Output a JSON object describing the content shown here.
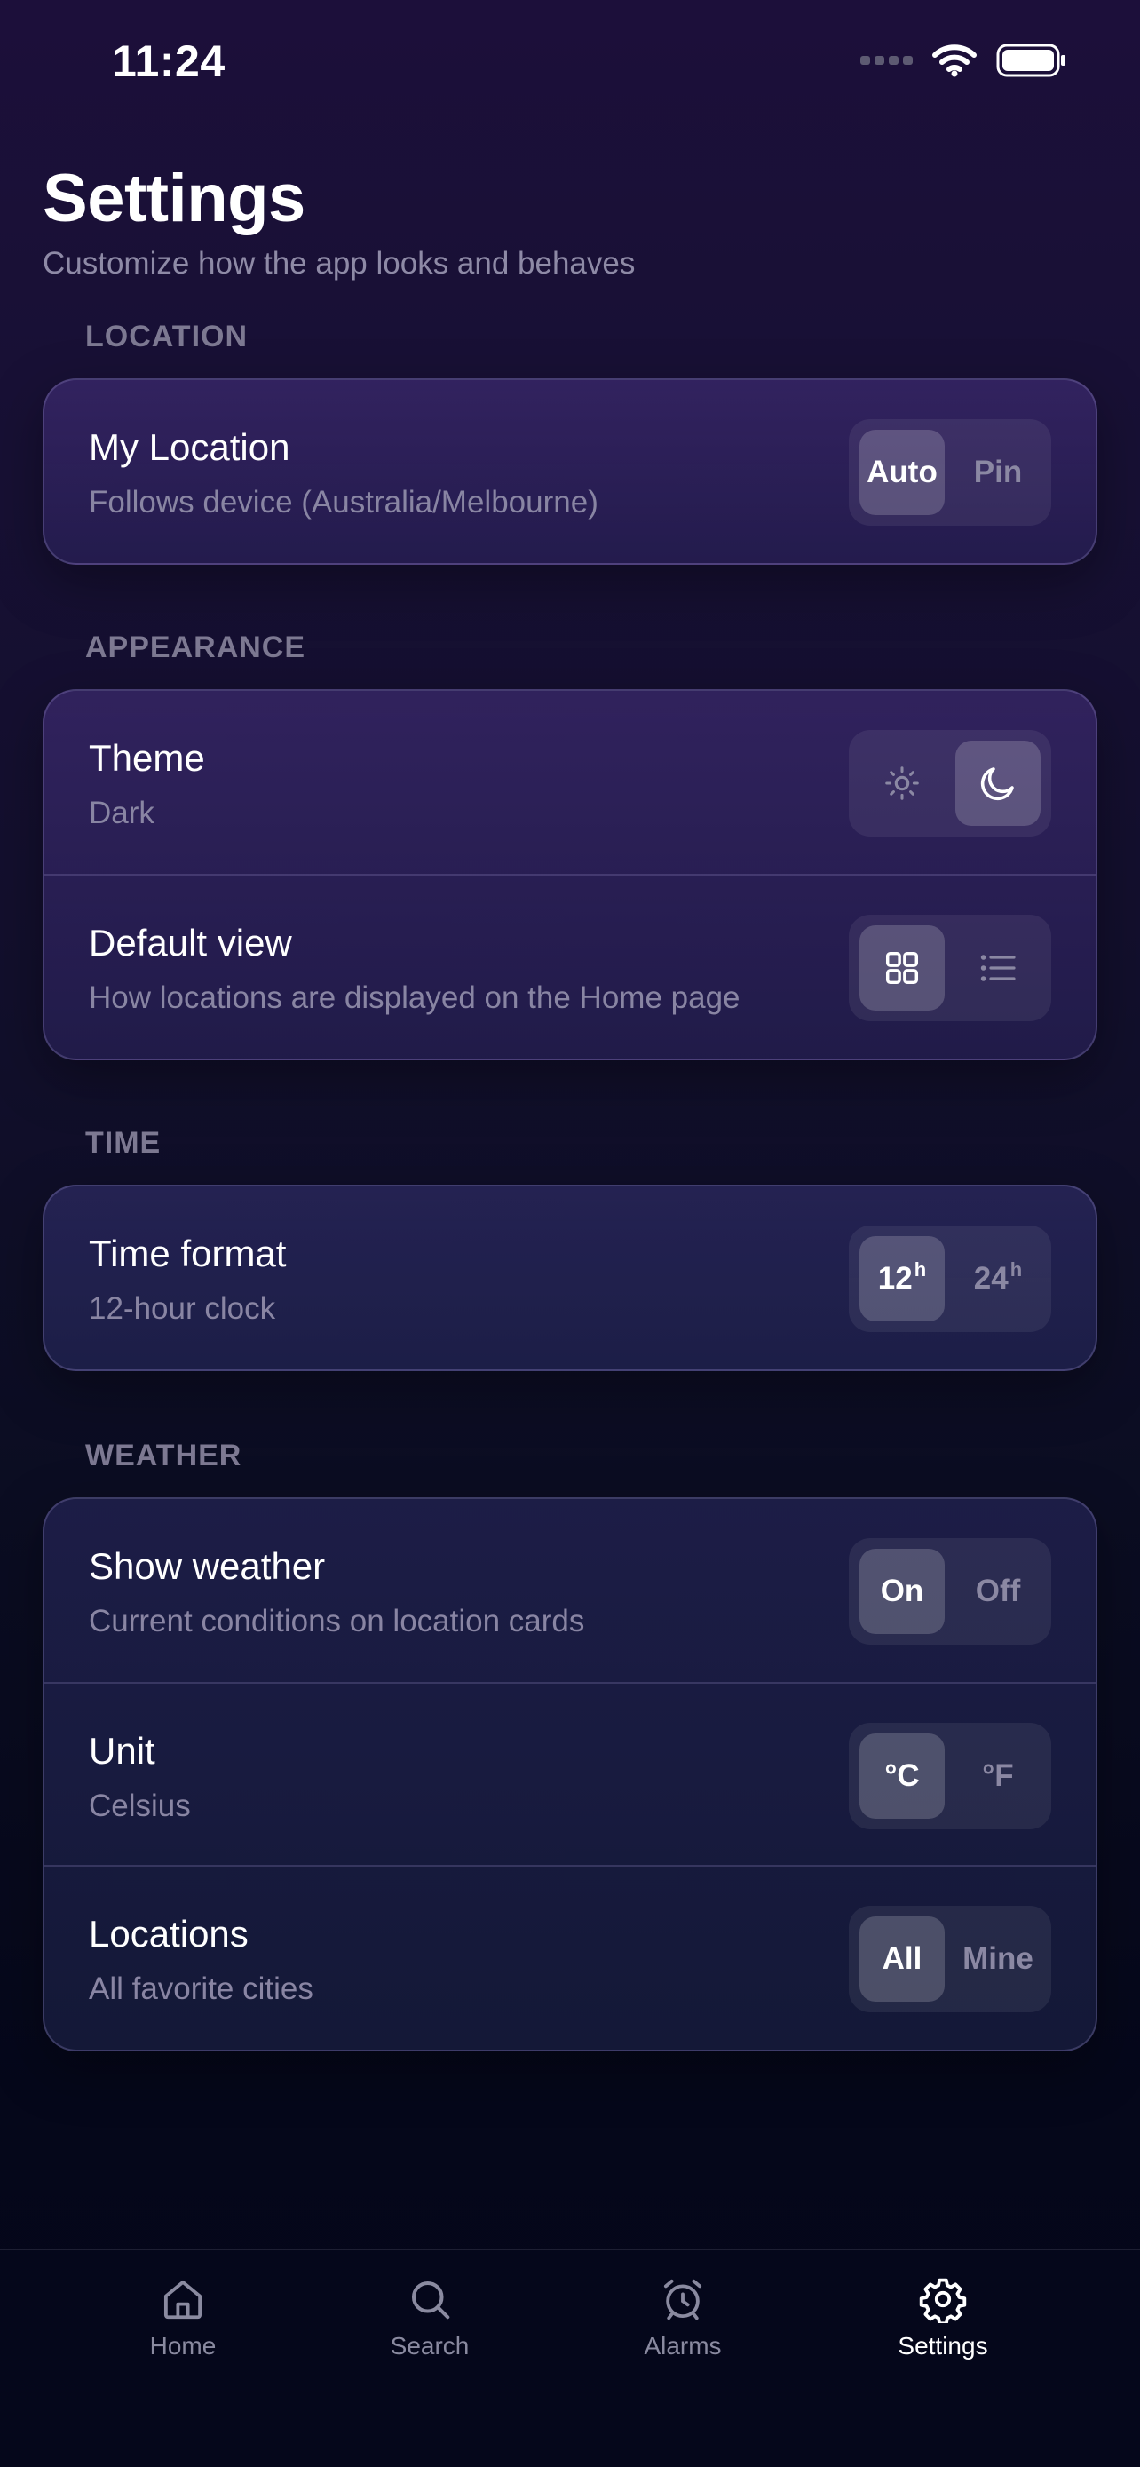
{
  "status_bar": {
    "time": "11:24"
  },
  "header": {
    "title": "Settings",
    "subtitle": "Customize how the app looks and behaves"
  },
  "sections": {
    "location": {
      "label": "LOCATION",
      "my_location": {
        "title": "My Location",
        "subtitle": "Follows device (Australia/Melbourne)",
        "options": [
          "Auto",
          "Pin"
        ],
        "selected": "Auto"
      }
    },
    "appearance": {
      "label": "APPEARANCE",
      "theme": {
        "title": "Theme",
        "subtitle": "Dark",
        "options_icons": [
          "sun-icon",
          "moon-icon"
        ],
        "selected": "moon-icon"
      },
      "default_view": {
        "title": "Default view",
        "subtitle": "How locations are displayed on the Home page",
        "options_icons": [
          "grid-icon",
          "list-icon"
        ],
        "selected": "grid-icon"
      }
    },
    "time": {
      "label": "TIME",
      "time_format": {
        "title": "Time format",
        "subtitle": "12-hour clock",
        "options": [
          {
            "value": "12",
            "suffix": "h"
          },
          {
            "value": "24",
            "suffix": "h"
          }
        ],
        "selected": "12h"
      }
    },
    "weather": {
      "label": "WEATHER",
      "show_weather": {
        "title": "Show weather",
        "subtitle": "Current conditions on location cards",
        "options": [
          "On",
          "Off"
        ],
        "selected": "On"
      },
      "unit": {
        "title": "Unit",
        "subtitle": "Celsius",
        "options": [
          "°C",
          "°F"
        ],
        "selected": "°C"
      },
      "locations": {
        "title": "Locations",
        "subtitle": "All favorite cities",
        "options": [
          "All",
          "Mine"
        ],
        "selected": "All"
      }
    }
  },
  "tab_bar": {
    "items": [
      {
        "label": "Home",
        "icon": "home-icon"
      },
      {
        "label": "Search",
        "icon": "search-icon"
      },
      {
        "label": "Alarms",
        "icon": "alarm-clock-icon"
      },
      {
        "label": "Settings",
        "icon": "gear-icon"
      }
    ],
    "active": "Settings"
  },
  "colors": {
    "active_tab": "#ffffff",
    "inactive_tab": "#8a8aa0",
    "muted_text": "#8985a3"
  }
}
